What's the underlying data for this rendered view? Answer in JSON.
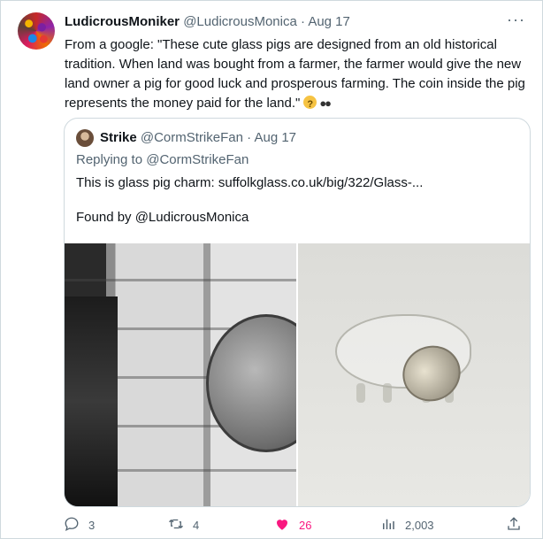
{
  "tweet": {
    "display_name": "LudicrousMoniker",
    "handle": "@LudicrousMonica",
    "date": "· Aug 17",
    "more_icon": "more-dots-icon",
    "text": "From a google: \"These cute glass pigs are designed from an old historical tradition. When land was bought from a farmer, the farmer would give the new land owner a pig for good luck and prosperous farming. The coin inside the pig represents the money paid for the land.\""
  },
  "quote": {
    "display_name": "Strike",
    "handle": "@CormStrikeFan",
    "date": "· Aug 17",
    "reply_line": "Replying to @CormStrikeFan",
    "body": "This is glass pig charm: suffolkglass.co.uk/big/322/Glass-...",
    "found_by": "Found by @LudicrousMonica"
  },
  "actions": {
    "replies": "3",
    "retweets": "4",
    "likes": "26",
    "views": "2,003"
  },
  "colors": {
    "like": "#f91880",
    "muted": "#536471",
    "border": "#cfd9de"
  }
}
